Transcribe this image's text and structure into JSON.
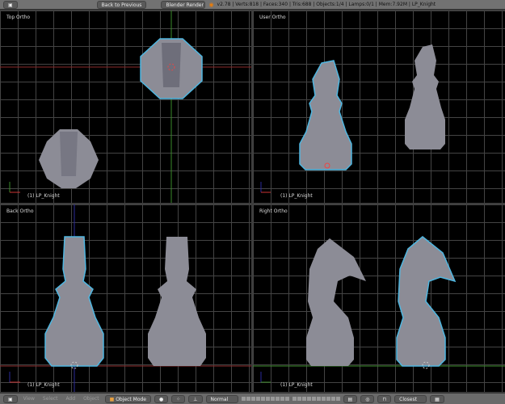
{
  "header": {
    "back_button": "Back to Previous",
    "render_engine": "Blender Render",
    "stats": "v2.78 | Verts:818 | Faces:340 | Tris:688 | Objects:1/4 | Lamps:0/1 | Mem:7.92M | LP_Knight"
  },
  "viewports": [
    {
      "name": "Top Ortho",
      "object": "(1) LP_Knight"
    },
    {
      "name": "User Ortho",
      "object": "(1) LP_Knight"
    },
    {
      "name": "Back Ortho",
      "object": "(1) LP_Knight"
    },
    {
      "name": "Right Ortho",
      "object": "(1) LP_Knight"
    }
  ],
  "footer": {
    "menus": [
      "View",
      "Select",
      "Add",
      "Object"
    ],
    "mode": "Object Mode",
    "orientation": "Normal",
    "snap": "Closest"
  },
  "colors": {
    "selection_outline": "#4fb6e0",
    "mesh": "#8c8c96",
    "x_axis": "#8a2a2a",
    "y_axis": "#3a8a2a",
    "z_axis": "#2a2a9a"
  }
}
